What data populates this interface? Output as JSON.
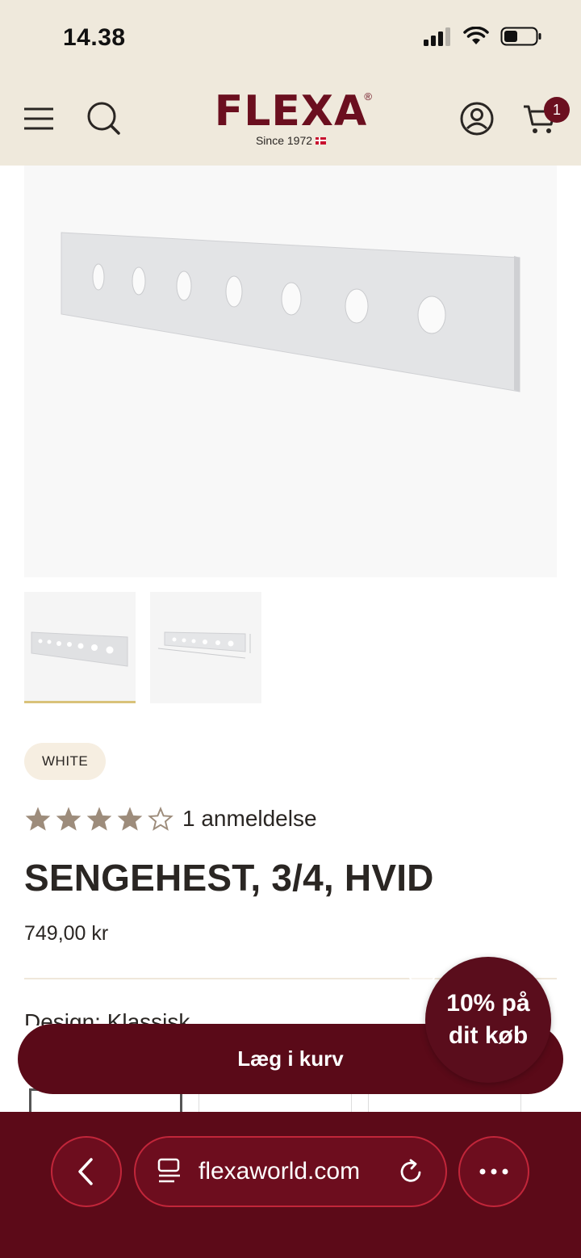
{
  "status_bar": {
    "time": "14.38"
  },
  "header": {
    "menu_icon": "hamburger-icon",
    "search_icon": "search-icon",
    "logo_word": "FLEXA",
    "logo_reg": "®",
    "logo_since": "Since 1972",
    "account_icon": "user-icon",
    "cart_icon": "cart-icon",
    "cart_count": "1",
    "brand_color": "#6b0f1f",
    "background": "#efe9dc"
  },
  "gallery": {
    "selected_index": 0,
    "thumbnail_count": 2
  },
  "product": {
    "color_badge": "WHITE",
    "rating_value": 4,
    "rating_max": 5,
    "reviews_label": "1 anmeldelse",
    "title": "SENGEHEST, 3/4, HVID",
    "price": "749,00 kr",
    "design_label": "Design: Klassisk"
  },
  "actions": {
    "add_to_cart": "Læg i kurv"
  },
  "promo": {
    "line1": "10% på",
    "line2": "dit køb"
  },
  "browser": {
    "url": "flexaworld.com",
    "back_icon": "chevron-left-icon",
    "tabs_icon": "page-icon",
    "reload_icon": "reload-icon",
    "more_icon": "more-icon",
    "bar_color": "#5c0a18"
  }
}
